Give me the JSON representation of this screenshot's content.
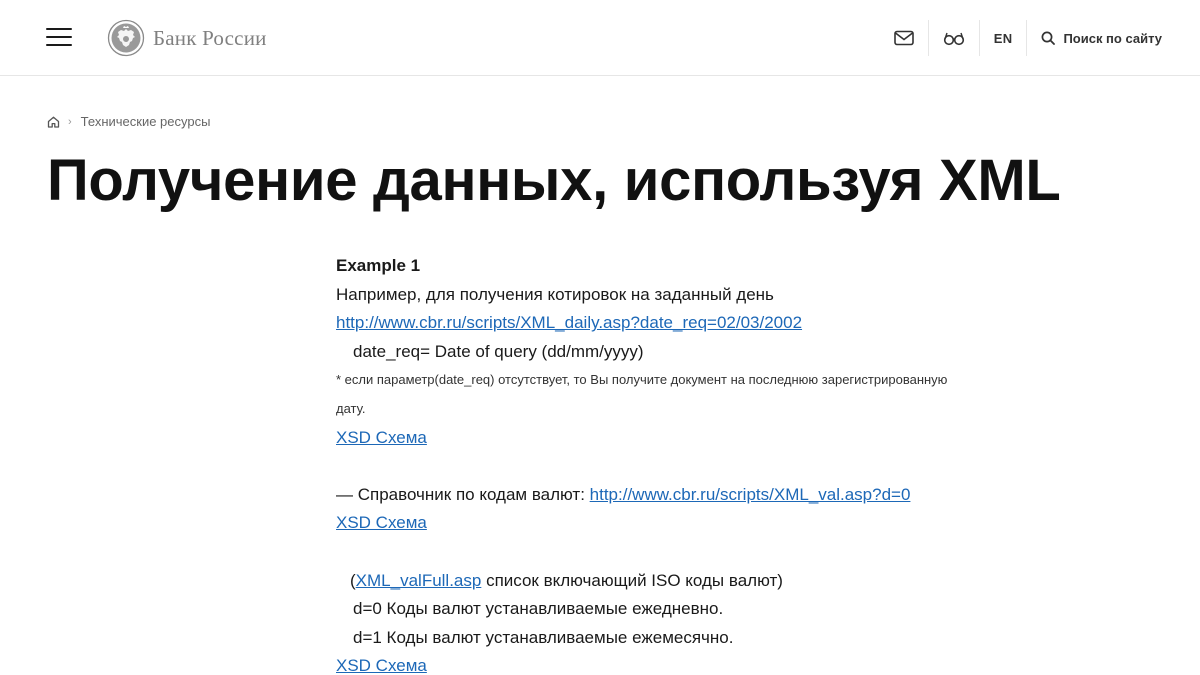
{
  "header": {
    "logo_text": "Банк России",
    "lang": "EN",
    "search_label": "Поиск по сайту"
  },
  "breadcrumb": {
    "items": [
      "Технические ресурсы"
    ]
  },
  "title": "Получение данных, используя XML",
  "content": {
    "example_title": "Example 1",
    "intro": "Например, для получения котировок на заданный день",
    "daily_url": "http://www.cbr.ru/scripts/XML_daily.asp?date_req=02/03/2002",
    "date_req_desc": "date_req= Date of query (dd/mm/yyyy)",
    "note_line1": "* если параметр(date_req) отсутствует, то Вы получите документ на последнюю зарегистрированную",
    "note_line2": "дату.",
    "xsd_link_1": "XSD Схема",
    "val_prefix": "— Справочник по кодам валют: ",
    "val_url": "http://www.cbr.ru/scripts/XML_val.asp?d=0",
    "xsd_link_2": "XSD Схема",
    "valfull_open": "(",
    "valfull_link": "XML_valFull.asp",
    "valfull_rest": " список включающий ISO коды валют)",
    "d0_desc": "d=0 Коды валют устанавливаемые ежедневно.",
    "d1_desc": "d=1 Коды валют устанавливаемые ежемесячно.",
    "xsd_link_3": "XSD Схема"
  },
  "colors": {
    "link": "#1d68b7",
    "text": "#1a1a1a",
    "logo_text": "#808080",
    "divider": "#e6e6e6"
  }
}
